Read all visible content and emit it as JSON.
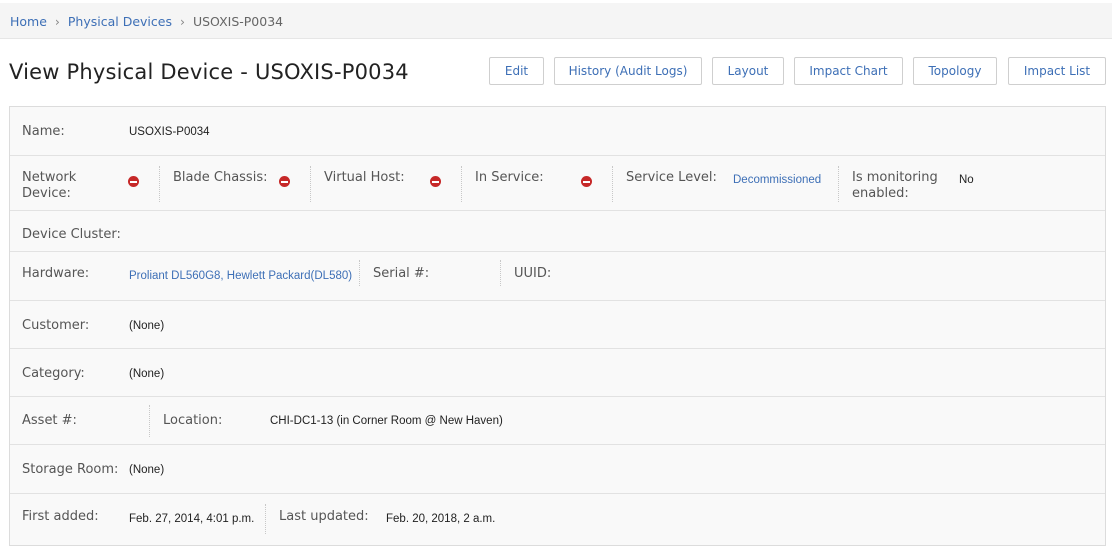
{
  "breadcrumb": {
    "home": "Home",
    "section": "Physical Devices",
    "current": "USOXIS-P0034",
    "separator": "›"
  },
  "page_title": "View Physical Device - USOXIS-P0034",
  "actions": {
    "edit": "Edit",
    "history": "History (Audit Logs)",
    "layout": "Layout",
    "impact_chart": "Impact Chart",
    "topology": "Topology",
    "impact_list": "Impact List"
  },
  "fields": {
    "name": {
      "label": "Name:",
      "value": "USOXIS-P0034"
    },
    "network_device": {
      "label": "Network Device:",
      "icon": "no-entry-icon"
    },
    "blade_chassis": {
      "label": "Blade Chassis:",
      "icon": "no-entry-icon"
    },
    "virtual_host": {
      "label": "Virtual Host:",
      "icon": "no-entry-icon"
    },
    "in_service": {
      "label": "In Service:",
      "icon": "no-entry-icon"
    },
    "service_level": {
      "label": "Service Level:",
      "value": "Decommissioned"
    },
    "monitoring": {
      "label": "Is monitoring enabled:",
      "value": "No"
    },
    "device_cluster": {
      "label": "Device Cluster:",
      "value": ""
    },
    "hardware": {
      "label": "Hardware:",
      "value": "Proliant DL560G8, Hewlett Packard(DL580)"
    },
    "serial": {
      "label": "Serial #:",
      "value": ""
    },
    "uuid": {
      "label": "UUID:",
      "value": ""
    },
    "customer": {
      "label": "Customer:",
      "value": "(None)"
    },
    "category": {
      "label": "Category:",
      "value": "(None)"
    },
    "asset": {
      "label": "Asset #:",
      "value": ""
    },
    "location": {
      "label": "Location:",
      "value": "CHI-DC1-13 (in Corner Room @ New Haven)"
    },
    "storage_room": {
      "label": "Storage Room:",
      "value": "(None)"
    },
    "first_added": {
      "label": "First added:",
      "value": "Feb. 27, 2014, 4:01 p.m."
    },
    "last_updated": {
      "label": "Last updated:",
      "value": "Feb. 20, 2018, 2 a.m."
    }
  },
  "colors": {
    "link": "#3d6fb6",
    "no_entry_icon": "#c62828"
  }
}
